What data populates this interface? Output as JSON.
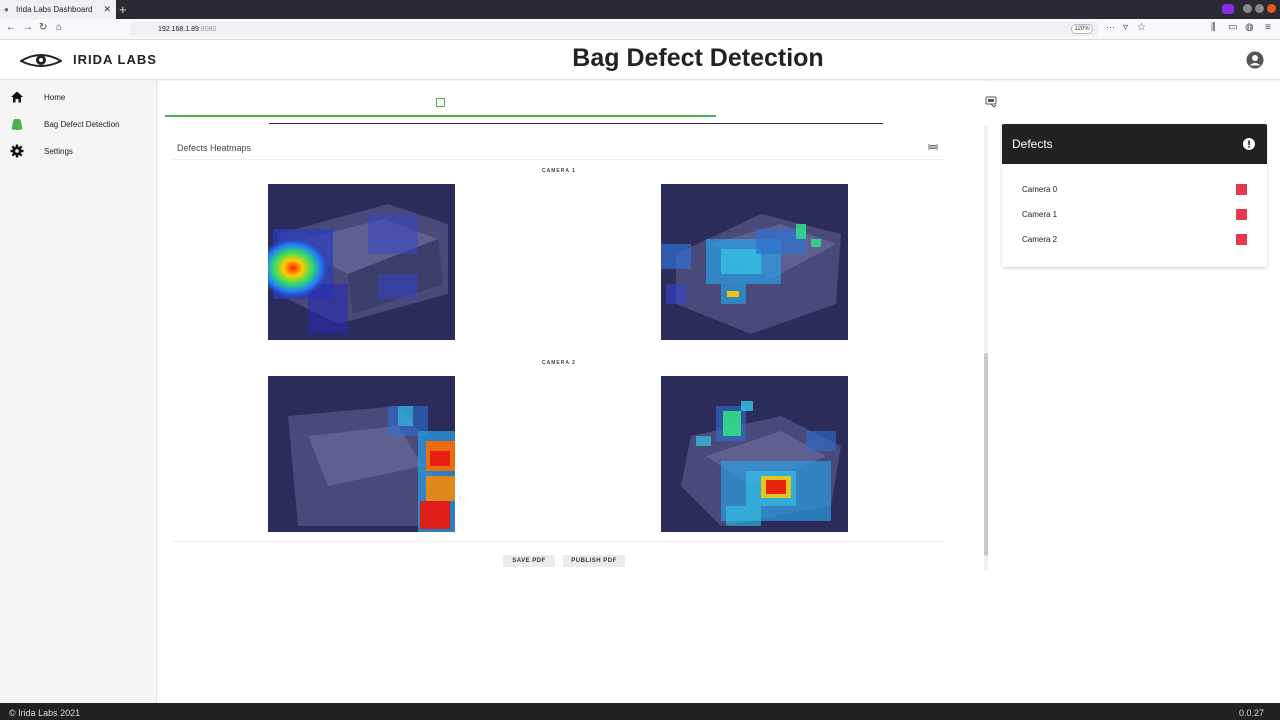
{
  "browser": {
    "tab_title": "Irida Labs Dashboard",
    "url_host": "192.168.1.89",
    "url_port": ":8080",
    "zoom": "120%"
  },
  "header": {
    "brand": "IRIDA LABS",
    "title": "Bag Defect Detection"
  },
  "sidebar": {
    "items": [
      {
        "label": "Home",
        "icon": "home-icon"
      },
      {
        "label": "Bag Defect Detection",
        "icon": "bag-icon"
      },
      {
        "label": "Settings",
        "icon": "gear-icon"
      }
    ]
  },
  "heatmaps": {
    "title": "Defects Heatmaps",
    "cameras": [
      {
        "label": "CAMERA 1"
      },
      {
        "label": "CAMERA 2"
      }
    ]
  },
  "actions": {
    "save_pdf": "SAVE PDF",
    "publish_pdf": "PUBLISH PDF"
  },
  "defects": {
    "title": "Defects",
    "items": [
      {
        "label": "Camera 0",
        "color": "#e53950"
      },
      {
        "label": "Camera 1",
        "color": "#e53950"
      },
      {
        "label": "Camera 2",
        "color": "#e53950"
      }
    ]
  },
  "footer": {
    "copyright": "© Irida Labs 2021",
    "version": "0.0.27"
  },
  "colors": {
    "accent_green": "#4caf50",
    "defect_red": "#e53950",
    "dark": "#212121"
  }
}
